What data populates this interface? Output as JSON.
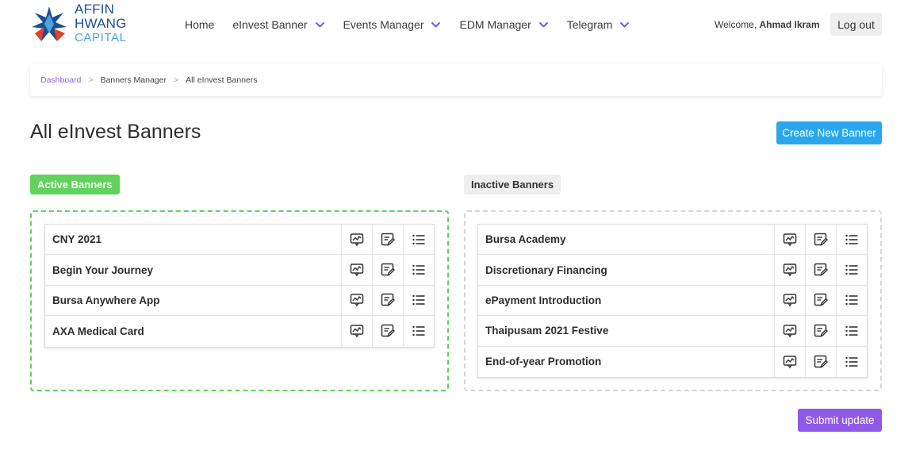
{
  "brand": {
    "line1": "AFFIN HWANG",
    "line2": "CAPITAL"
  },
  "nav": [
    {
      "label": "Home",
      "dropdown": false
    },
    {
      "label": "eInvest Banner",
      "dropdown": true
    },
    {
      "label": "Events Manager",
      "dropdown": true
    },
    {
      "label": "EDM Manager",
      "dropdown": true
    },
    {
      "label": "Telegram",
      "dropdown": true
    }
  ],
  "user": {
    "welcome": "Welcome,",
    "name": "Ahmad Ikram",
    "logout": "Log out"
  },
  "breadcrumb": {
    "items": [
      "Dashboard",
      "Banners Manager",
      "All eInvest Banners"
    ],
    "separator": ">"
  },
  "page": {
    "title": "All eInvest Banners",
    "create_button": "Create New Banner",
    "submit_button": "Submit update"
  },
  "active": {
    "label": "Active Banners",
    "banners": [
      "CNY 2021",
      "Begin Your Journey",
      "Bursa Anywhere App",
      "AXA Medical Card"
    ]
  },
  "inactive": {
    "label": "Inactive Banners",
    "banners": [
      "Bursa Academy",
      "Discretionary Financing",
      "ePayment Introduction",
      "Thaipusam 2021 Festive",
      "End-of-year Promotion"
    ]
  },
  "row_actions": [
    "preview-icon",
    "edit-icon",
    "list-icon"
  ],
  "colors": {
    "accent_purple": "#8f5ae8",
    "nav_chevron": "#6b5ce7",
    "create_blue": "#2aa7ec",
    "active_green": "#5fd35c",
    "inactive_gray": "#d6d6d6",
    "breadcrumb_link": "#8b67d8"
  }
}
